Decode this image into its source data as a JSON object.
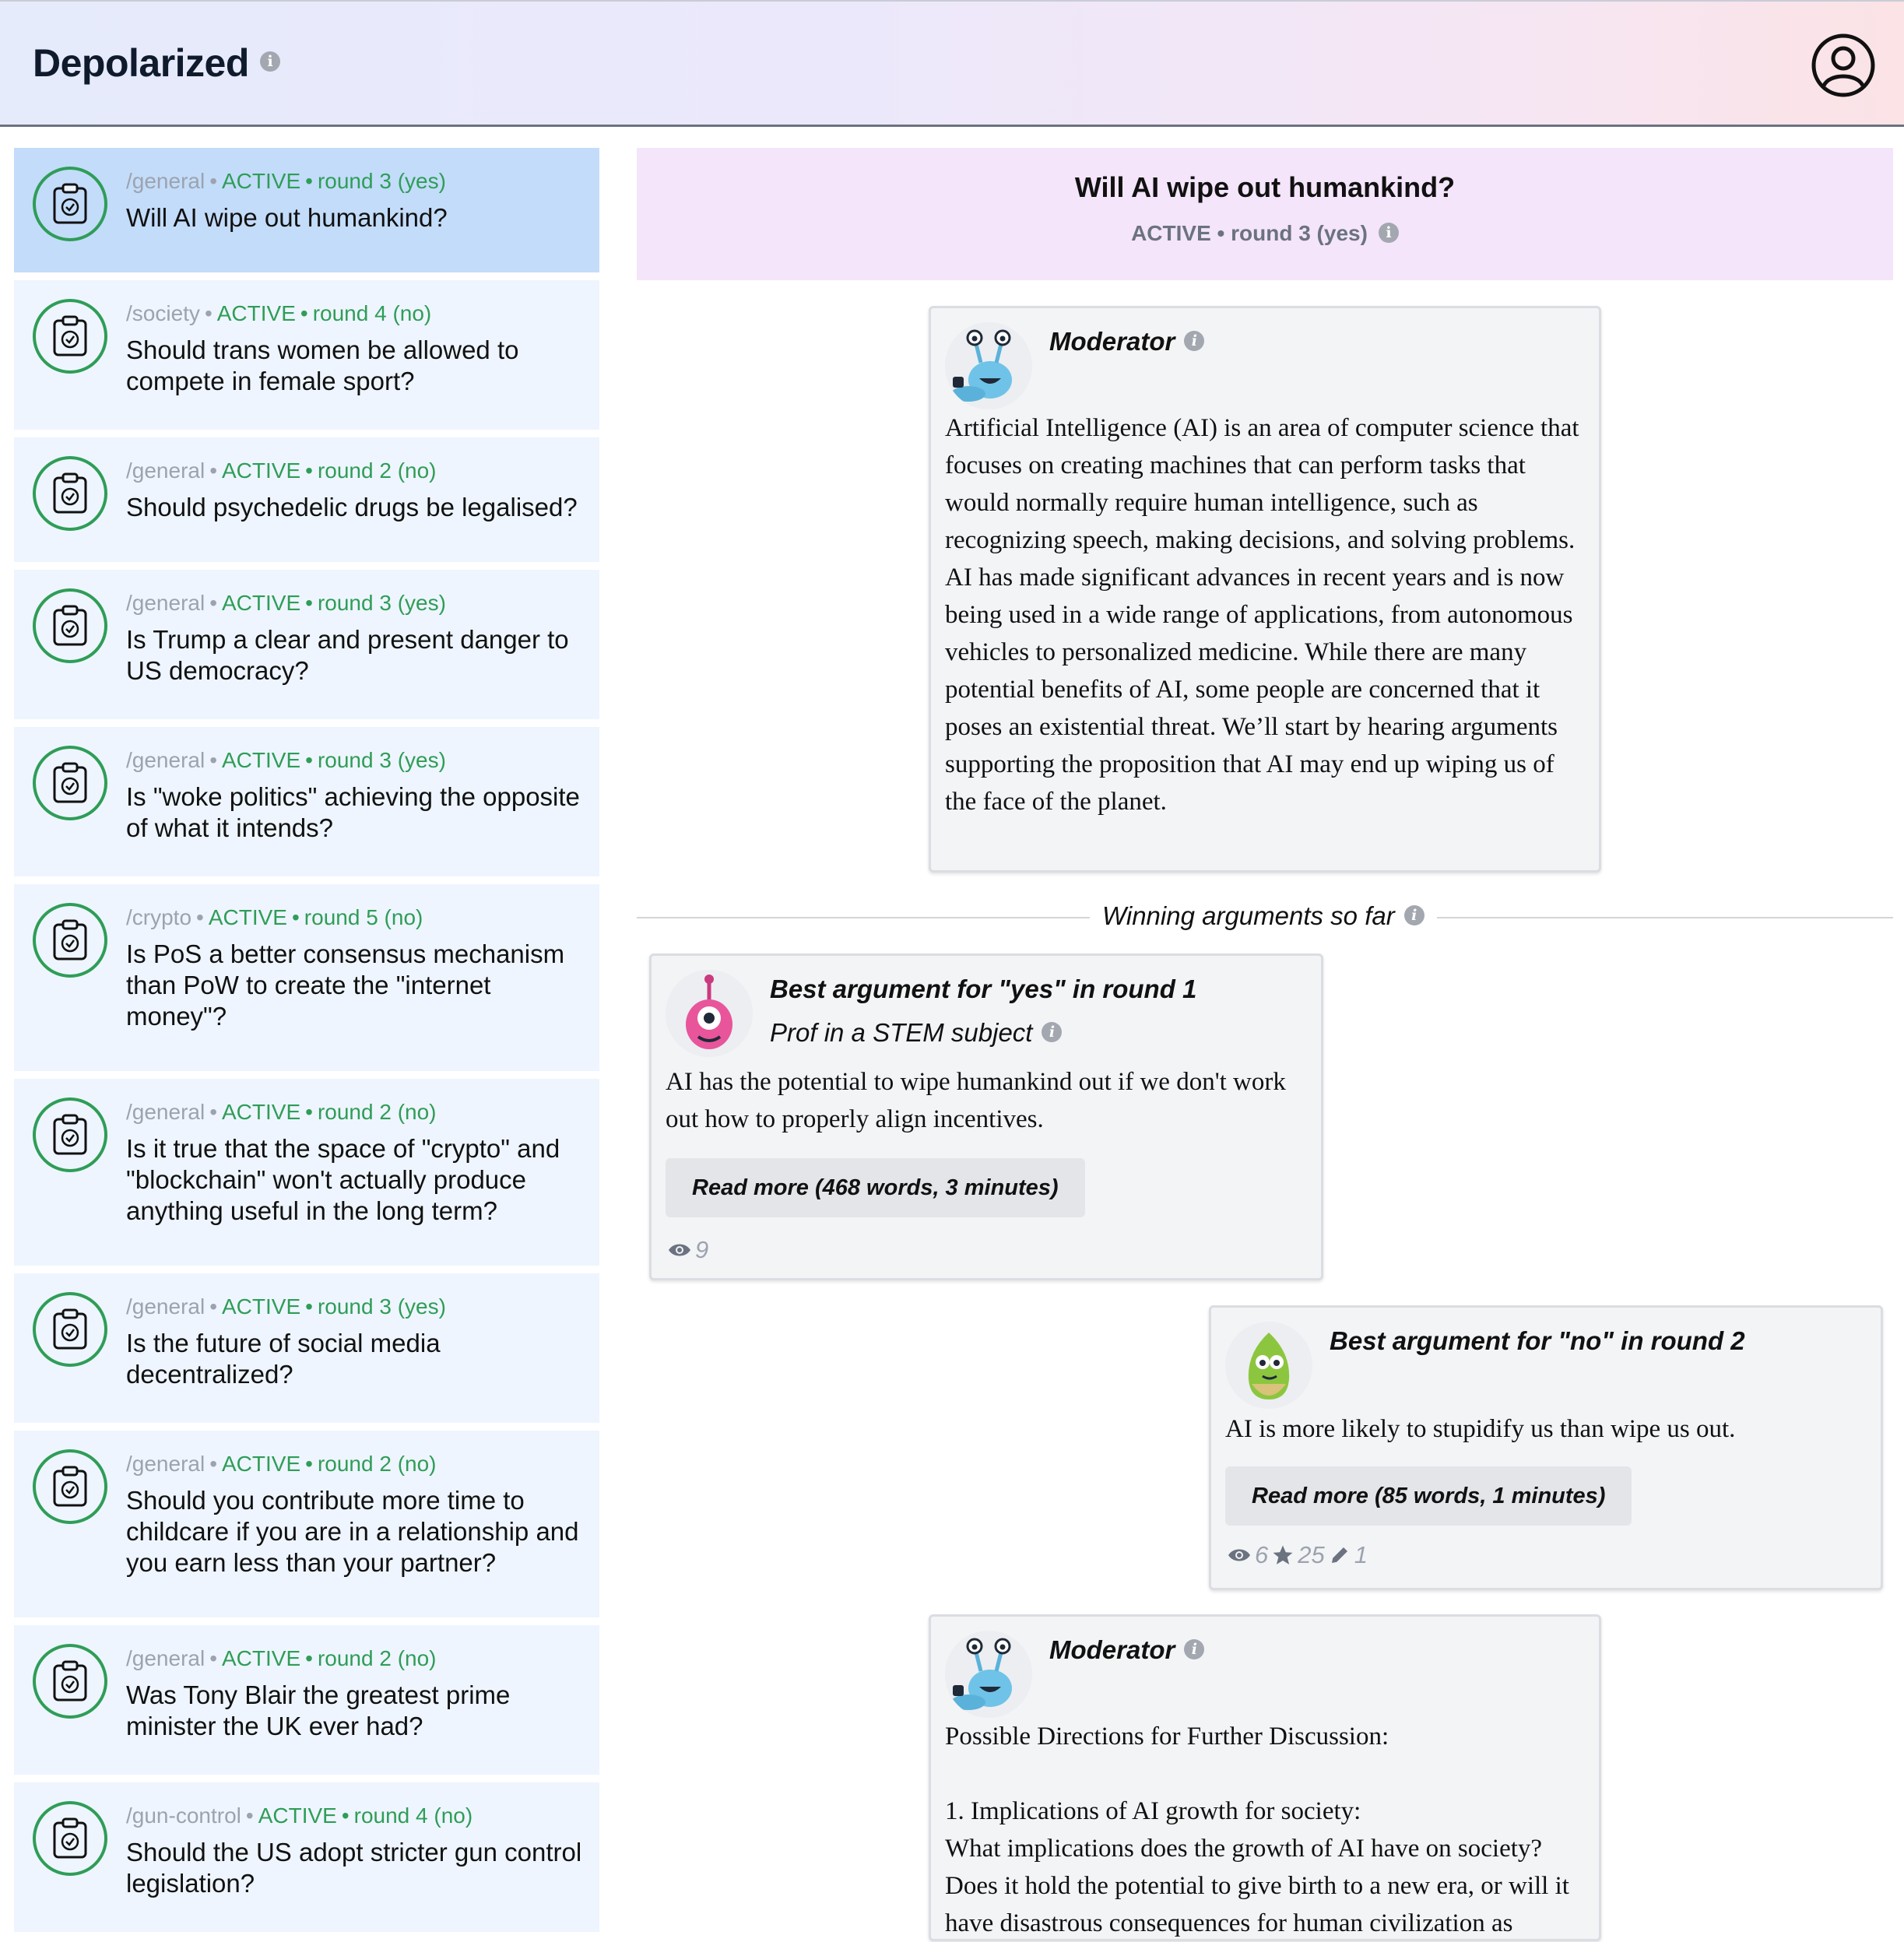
{
  "app": {
    "title": "Depolarized"
  },
  "icons": {
    "info": "info-icon",
    "profile": "user-circle-icon",
    "topic": "clipboard-check-icon",
    "views": "eye-icon",
    "stars": "star-icon",
    "edits": "pencil-icon"
  },
  "colors": {
    "active_green": "#2f9d57",
    "selected_bg": "#c3dcfa",
    "item_bg": "#eef5fe",
    "main_header_bg": "#f4e5fa"
  },
  "sidebar": {
    "items": [
      {
        "path": "/general",
        "status": "ACTIVE",
        "round": "round 3 (yes)",
        "question": "Will AI wipe out humankind?",
        "selected": true
      },
      {
        "path": "/society",
        "status": "ACTIVE",
        "round": "round 4 (no)",
        "question": "Should trans women be allowed to compete in female sport?"
      },
      {
        "path": "/general",
        "status": "ACTIVE",
        "round": "round 2 (no)",
        "question": "Should psychedelic drugs be legalised?"
      },
      {
        "path": "/general",
        "status": "ACTIVE",
        "round": "round 3 (yes)",
        "question": "Is Trump a clear and present danger to US democracy?"
      },
      {
        "path": "/general",
        "status": "ACTIVE",
        "round": "round 3 (yes)",
        "question": "Is \"woke politics\" achieving the opposite of what it intends?"
      },
      {
        "path": "/crypto",
        "status": "ACTIVE",
        "round": "round 5 (no)",
        "question": "Is PoS a better consensus mechanism than PoW to create the \"internet money\"?"
      },
      {
        "path": "/general",
        "status": "ACTIVE",
        "round": "round 2 (no)",
        "question": "Is it true that the space of \"crypto\" and \"blockchain\" won't actually produce anything useful in the long term?"
      },
      {
        "path": "/general",
        "status": "ACTIVE",
        "round": "round 3 (yes)",
        "question": "Is the future of social media decentralized?"
      },
      {
        "path": "/general",
        "status": "ACTIVE",
        "round": "round 2 (no)",
        "question": "Should you contribute more time to childcare if you are in a relationship and you earn less than your partner?"
      },
      {
        "path": "/general",
        "status": "ACTIVE",
        "round": "round 2 (no)",
        "question": "Was Tony Blair the greatest prime minister the UK ever had?"
      },
      {
        "path": "/gun-control",
        "status": "ACTIVE",
        "round": "round 4 (no)",
        "question": "Should the US adopt stricter gun control legislation?"
      }
    ]
  },
  "main": {
    "title": "Will AI wipe out humankind?",
    "status_line": "ACTIVE • round 3 (yes)",
    "moderator1": {
      "name": "Moderator",
      "text": "Artificial Intelligence (AI) is an area of computer science that focuses on creating machines that can perform tasks that would normally require human intelligence, such as recognizing speech, making decisions, and solving problems. AI has made significant advances in recent years and is now being used in a wide range of applications, from autonomous vehicles to personalized medicine. While there are many potential benefits of AI, some people are concerned that it poses an existential threat. We’ll start by hearing arguments supporting the proposition that AI may end up wiping us of the face of the planet."
    },
    "winning_label": "Winning arguments so far",
    "arg1": {
      "title": "Best argument for \"yes\" in round 1",
      "role": "Prof in a STEM subject",
      "text": "AI has the potential to wipe humankind out if we don't work out how to properly align incentives.",
      "read_more": "Read more (468 words, 3 minutes)",
      "views": "9"
    },
    "arg2": {
      "title": "Best argument for \"no\" in round 2",
      "text": "AI is more likely to stupidify us than wipe us out.",
      "read_more": "Read more (85 words, 1 minutes)",
      "views": "6",
      "stars": "25",
      "edits": "1"
    },
    "moderator2": {
      "name": "Moderator",
      "intro": "Possible Directions for Further Discussion:",
      "point1_title": "1. Implications of AI growth for society:",
      "point1_text": "What implications does the growth of AI have on society? Does it hold the potential to give birth to a new era, or will it have disastrous consequences for human civilization as"
    }
  }
}
